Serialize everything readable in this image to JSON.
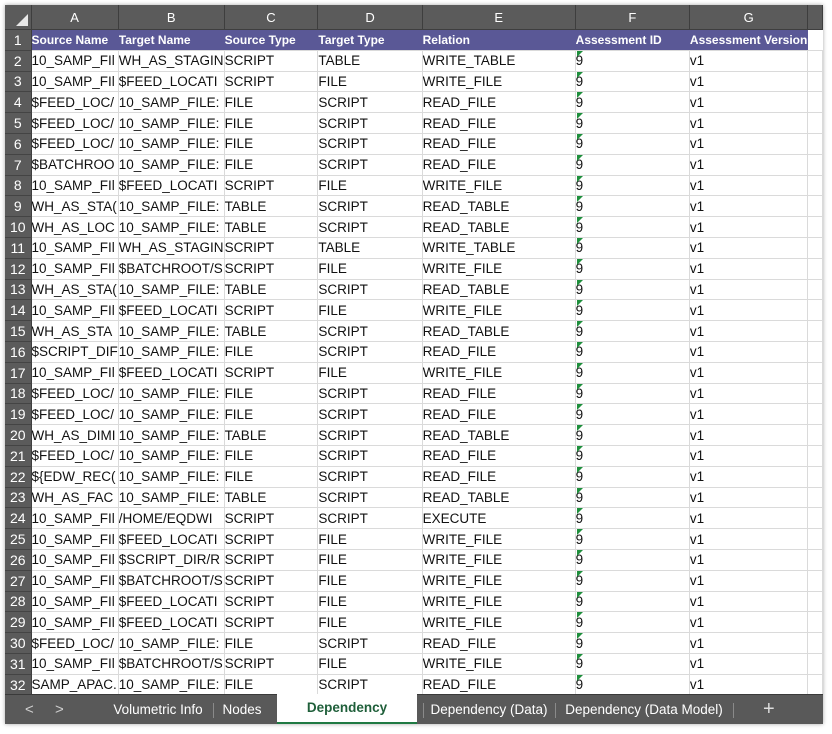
{
  "columns": [
    "A",
    "B",
    "C",
    "D",
    "E",
    "F",
    "G"
  ],
  "header_row": {
    "row_num": "1",
    "cells": [
      "Source Name",
      "Target Name",
      "Source Type",
      "Target Type",
      "Relation",
      "Assessment ID",
      "Assessment Version"
    ]
  },
  "rows": [
    [
      "2",
      "10_SAMP_FIl",
      "WH_AS_STAGIN",
      "SCRIPT",
      "TABLE",
      "WRITE_TABLE",
      "9",
      "v1"
    ],
    [
      "3",
      "10_SAMP_FIl",
      "$FEED_LOCATI",
      "SCRIPT",
      "FILE",
      "WRITE_FILE",
      "9",
      "v1"
    ],
    [
      "4",
      "$FEED_LOC/",
      "10_SAMP_FILE:",
      "FILE",
      "SCRIPT",
      "READ_FILE",
      "9",
      "v1"
    ],
    [
      "5",
      "$FEED_LOC/",
      "10_SAMP_FILE:",
      "FILE",
      "SCRIPT",
      "READ_FILE",
      "9",
      "v1"
    ],
    [
      "6",
      "$FEED_LOC/",
      "10_SAMP_FILE:",
      "FILE",
      "SCRIPT",
      "READ_FILE",
      "9",
      "v1"
    ],
    [
      "7",
      "$BATCHROO",
      "10_SAMP_FILE:",
      "FILE",
      "SCRIPT",
      "READ_FILE",
      "9",
      "v1"
    ],
    [
      "8",
      "10_SAMP_FIl",
      "$FEED_LOCATI",
      "SCRIPT",
      "FILE",
      "WRITE_FILE",
      "9",
      "v1"
    ],
    [
      "9",
      "WH_AS_STA(",
      "10_SAMP_FILE:",
      "TABLE",
      "SCRIPT",
      "READ_TABLE",
      "9",
      "v1"
    ],
    [
      "10",
      " WH_AS_LOC",
      "10_SAMP_FILE:",
      "TABLE",
      "SCRIPT",
      "READ_TABLE",
      "9",
      "v1"
    ],
    [
      "11",
      "10_SAMP_FIl",
      "WH_AS_STAGIN",
      "SCRIPT",
      "TABLE",
      "WRITE_TABLE",
      "9",
      "v1"
    ],
    [
      "12",
      "10_SAMP_FIl",
      "$BATCHROOT/S",
      "SCRIPT",
      "FILE",
      "WRITE_FILE",
      "9",
      "v1"
    ],
    [
      "13",
      "WH_AS_STA(",
      "10_SAMP_FILE:",
      "TABLE",
      "SCRIPT",
      "READ_TABLE",
      "9",
      "v1"
    ],
    [
      "14",
      "10_SAMP_FIl",
      "$FEED_LOCATI",
      "SCRIPT",
      "FILE",
      "WRITE_FILE",
      "9",
      "v1"
    ],
    [
      "15",
      " WH_AS_STA",
      "10_SAMP_FILE:",
      "TABLE",
      "SCRIPT",
      "READ_TABLE",
      "9",
      "v1"
    ],
    [
      "16",
      "$SCRIPT_DIF",
      "10_SAMP_FILE:",
      "FILE",
      "SCRIPT",
      "READ_FILE",
      "9",
      "v1"
    ],
    [
      "17",
      "10_SAMP_FIl",
      "$FEED_LOCATI",
      "SCRIPT",
      "FILE",
      "WRITE_FILE",
      "9",
      "v1"
    ],
    [
      "18",
      "$FEED_LOC/",
      "10_SAMP_FILE:",
      "FILE",
      "SCRIPT",
      "READ_FILE",
      "9",
      "v1"
    ],
    [
      "19",
      "$FEED_LOC/",
      "10_SAMP_FILE:",
      "FILE",
      "SCRIPT",
      "READ_FILE",
      "9",
      "v1"
    ],
    [
      "20",
      "WH_AS_DIMI",
      "10_SAMP_FILE:",
      "TABLE",
      "SCRIPT",
      "READ_TABLE",
      "9",
      "v1"
    ],
    [
      "21",
      "$FEED_LOC/",
      "10_SAMP_FILE:",
      "FILE",
      "SCRIPT",
      "READ_FILE",
      "9",
      "v1"
    ],
    [
      "22",
      "${EDW_REC(",
      "10_SAMP_FILE:",
      "FILE",
      "SCRIPT",
      "READ_FILE",
      "9",
      "v1"
    ],
    [
      "23",
      " WH_AS_FAC",
      "10_SAMP_FILE:",
      "TABLE",
      "SCRIPT",
      "READ_TABLE",
      "9",
      "v1"
    ],
    [
      "24",
      "10_SAMP_FIl",
      "/HOME/EQDWI",
      "SCRIPT",
      "SCRIPT",
      "EXECUTE",
      "9",
      "v1"
    ],
    [
      "25",
      "10_SAMP_FIl",
      "$FEED_LOCATI",
      "SCRIPT",
      "FILE",
      "WRITE_FILE",
      "9",
      "v1"
    ],
    [
      "26",
      "10_SAMP_FIl",
      "$SCRIPT_DIR/R",
      "SCRIPT",
      "FILE",
      "WRITE_FILE",
      "9",
      "v1"
    ],
    [
      "27",
      "10_SAMP_FIl",
      "$BATCHROOT/S",
      "SCRIPT",
      "FILE",
      "WRITE_FILE",
      "9",
      "v1"
    ],
    [
      "28",
      "10_SAMP_FIl",
      "$FEED_LOCATI",
      "SCRIPT",
      "FILE",
      "WRITE_FILE",
      "9",
      "v1"
    ],
    [
      "29",
      "10_SAMP_FIl",
      "$FEED_LOCATI",
      "SCRIPT",
      "FILE",
      "WRITE_FILE",
      "9",
      "v1"
    ],
    [
      "30",
      "$FEED_LOC/",
      "10_SAMP_FILE:",
      "FILE",
      "SCRIPT",
      "READ_FILE",
      "9",
      "v1"
    ],
    [
      "31",
      "10_SAMP_FIl",
      "$BATCHROOT/S",
      "SCRIPT",
      "FILE",
      "WRITE_FILE",
      "9",
      "v1"
    ],
    [
      "32",
      "SAMP_APAC.",
      "10_SAMP_FILE:",
      "FILE",
      "SCRIPT",
      "READ_FILE",
      "9",
      "v1"
    ]
  ],
  "sheet_tabs": {
    "nav_prev": "<",
    "nav_next": ">",
    "tabs": [
      "Volumetric Info",
      "Nodes",
      "Dependency (Process)",
      "Dependency (Data)",
      "Dependency (Data Model)"
    ],
    "active_index": 2,
    "add": "+"
  },
  "colors": {
    "header_fill": "#5a5896",
    "chrome": "#5b5b5b",
    "active_tab_text": "#1f5f3a",
    "number_flag": "#1e8f3c"
  }
}
